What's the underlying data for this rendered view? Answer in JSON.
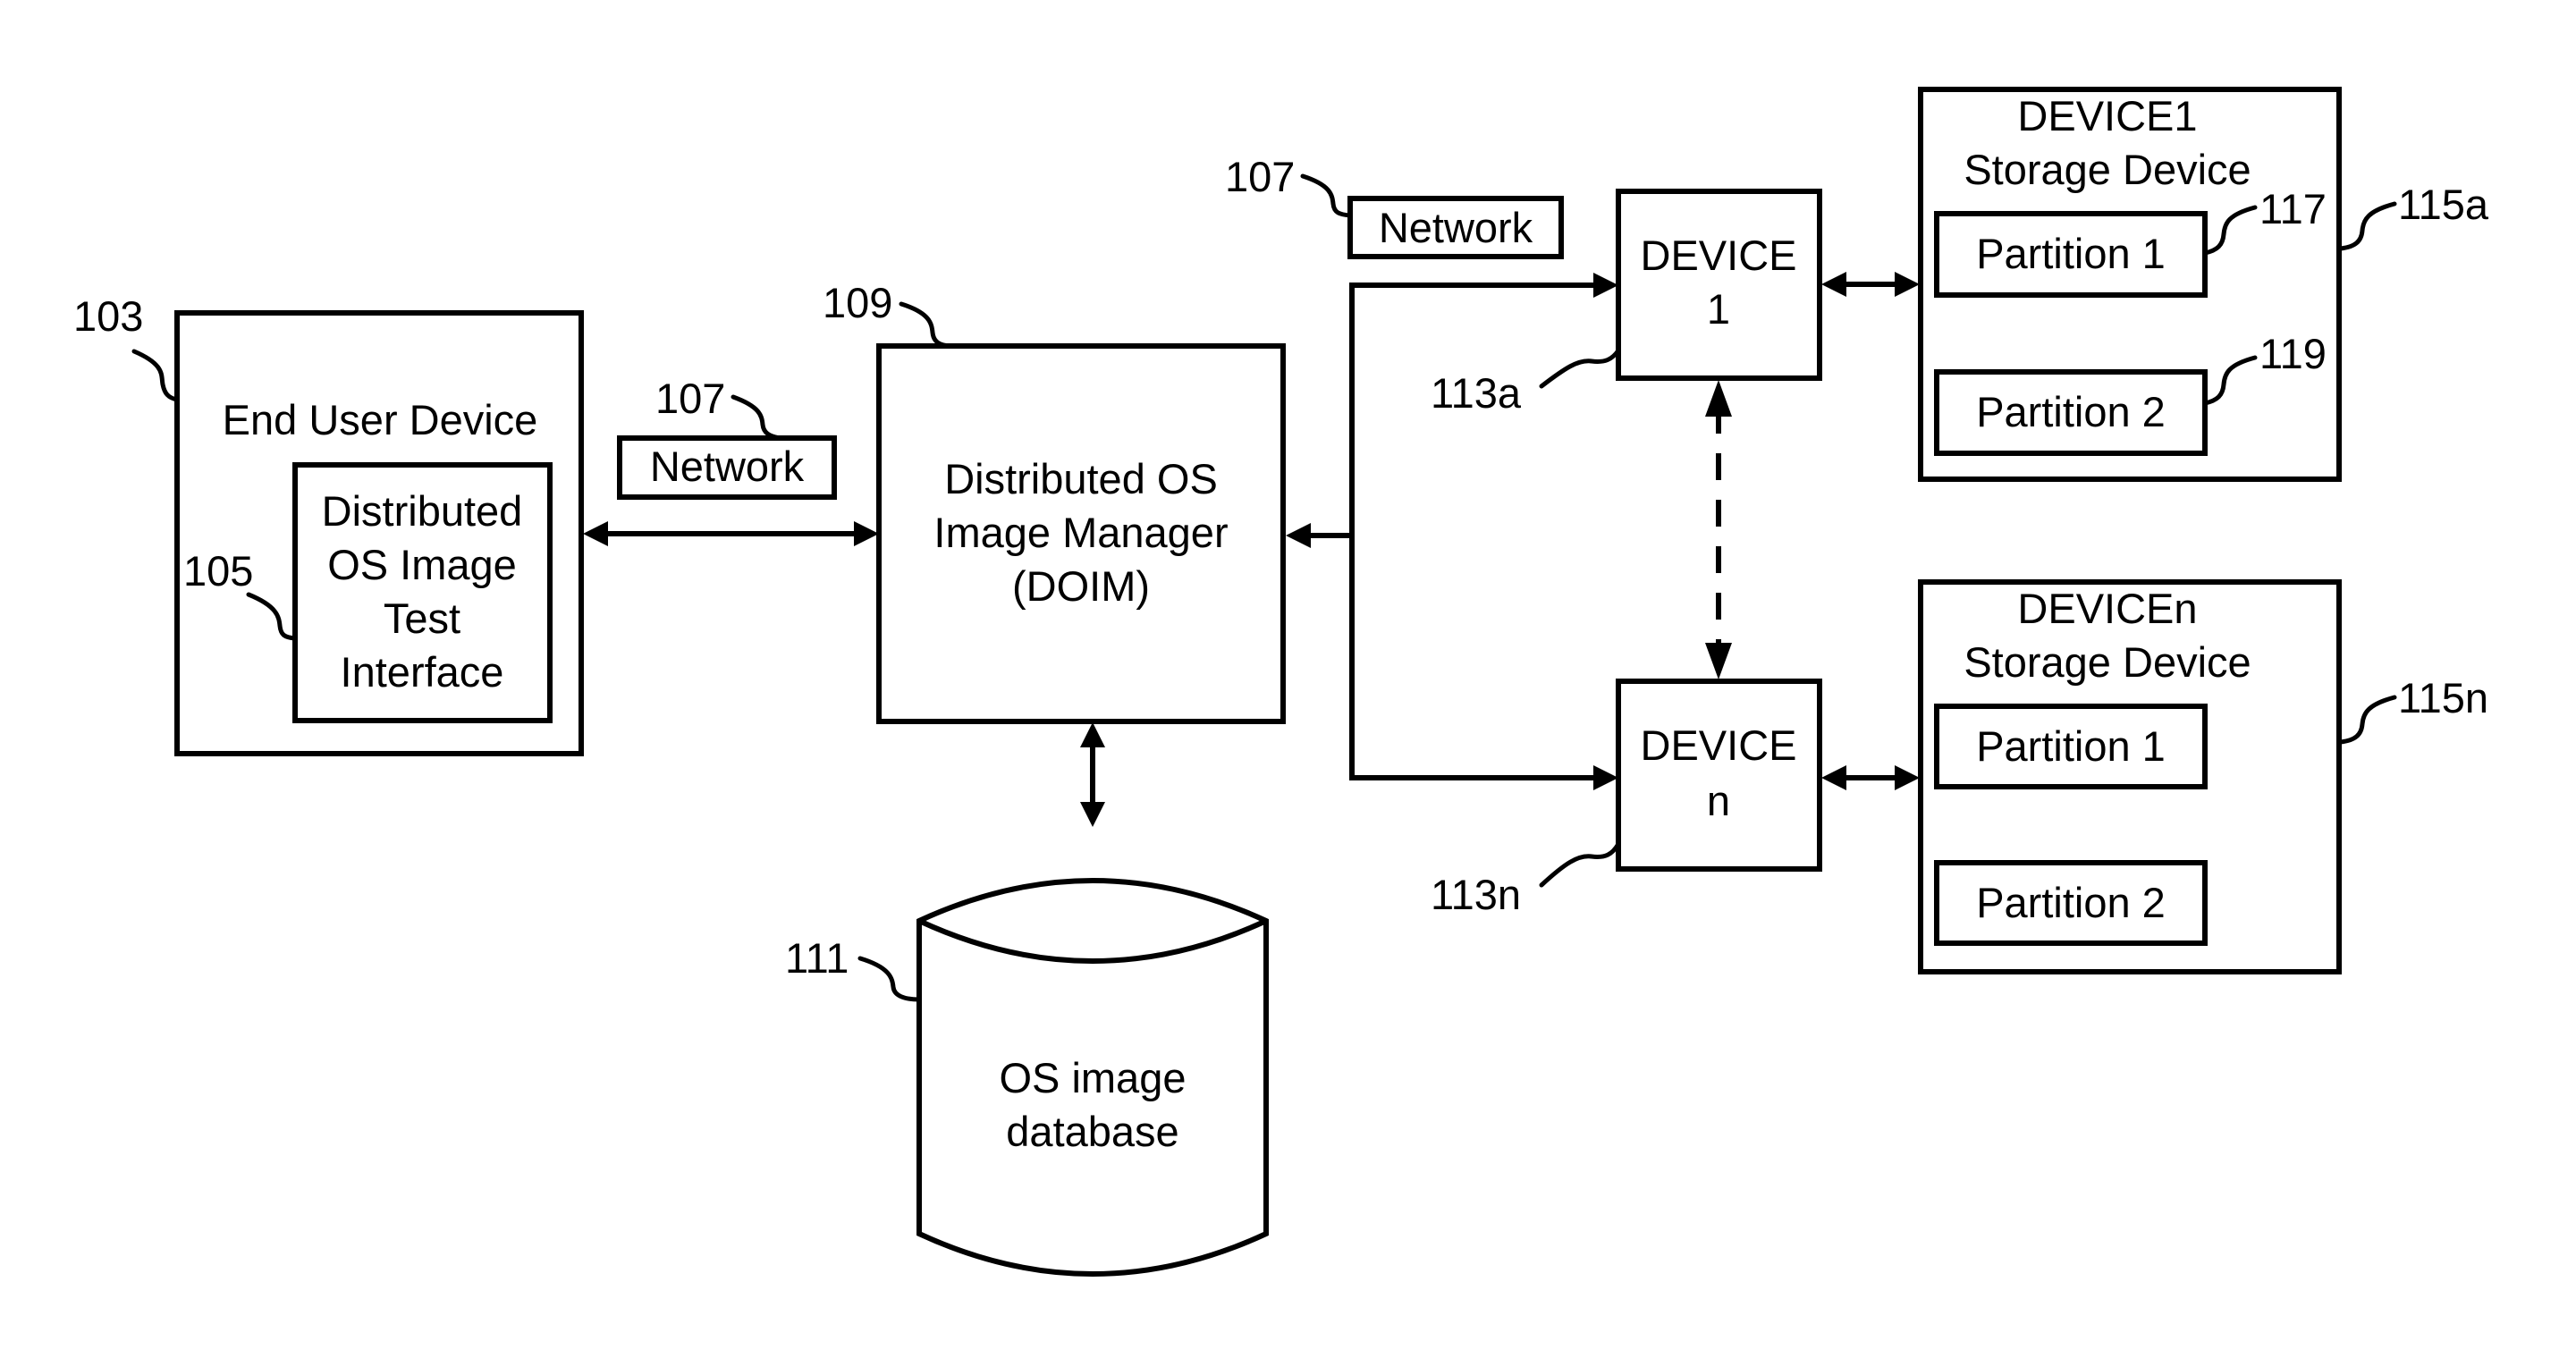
{
  "diagram": {
    "end_user_device": {
      "ref": "103",
      "label": "End User Device",
      "test_interface": {
        "ref": "105",
        "lines": [
          "Distributed",
          "OS Image",
          "Test",
          "Interface"
        ]
      }
    },
    "network_left": {
      "ref": "107",
      "label": "Network"
    },
    "doim": {
      "ref": "109",
      "lines": [
        "Distributed OS",
        "Image Manager",
        "(DOIM)"
      ]
    },
    "database": {
      "ref": "111",
      "lines": [
        "OS image",
        "database"
      ]
    },
    "network_right": {
      "ref": "107",
      "label": "Network"
    },
    "device_1": {
      "ref": "113a",
      "lines": [
        "DEVICE",
        "1"
      ]
    },
    "device_n": {
      "ref": "113n",
      "lines": [
        "DEVICE",
        "n"
      ]
    },
    "storage_1": {
      "ref": "115a",
      "lines": [
        "DEVICE1",
        "Storage Device"
      ],
      "partitions": [
        {
          "label": "Partition 1",
          "ref": "117"
        },
        {
          "label": "Partition 2",
          "ref": "119"
        }
      ]
    },
    "storage_n": {
      "ref": "115n",
      "lines": [
        "DEVICEn",
        "Storage Device"
      ],
      "partitions": [
        {
          "label": "Partition 1",
          "ref": ""
        },
        {
          "label": "Partition 2",
          "ref": ""
        }
      ]
    },
    "connections": [
      {
        "from": "End User Device",
        "to": "DOIM",
        "style": "bidirectional",
        "via": "Network"
      },
      {
        "from": "DOIM",
        "to": "OS image database",
        "style": "bidirectional"
      },
      {
        "from": "Network bus",
        "to": "DOIM",
        "style": "arrow"
      },
      {
        "from": "Network bus",
        "to": "DEVICE 1",
        "style": "arrow"
      },
      {
        "from": "Network bus",
        "to": "DEVICE n",
        "style": "arrow"
      },
      {
        "from": "DEVICE 1",
        "to": "DEVICE n",
        "style": "dashed-bidirectional"
      },
      {
        "from": "DEVICE 1",
        "to": "DEVICE1 Storage Device",
        "style": "bidirectional"
      },
      {
        "from": "DEVICE n",
        "to": "DEVICEn Storage Device",
        "style": "bidirectional"
      }
    ]
  }
}
